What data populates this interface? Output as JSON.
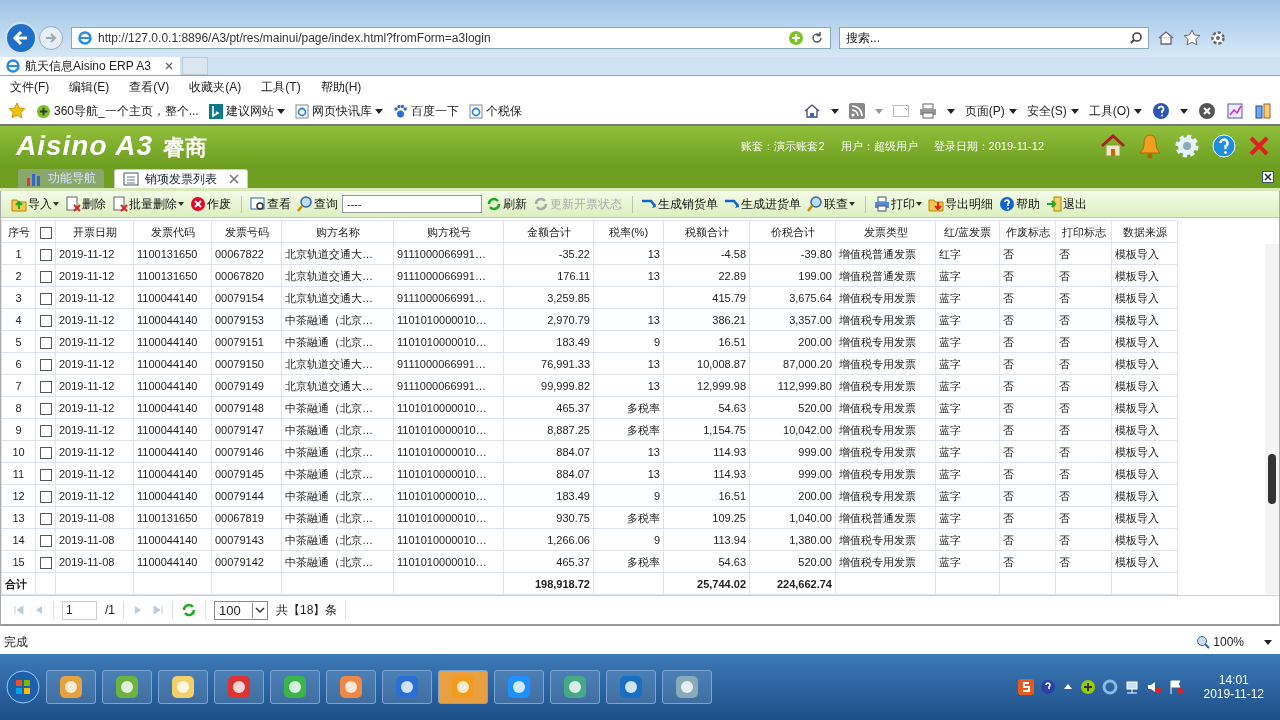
{
  "browser": {
    "url": "http://127.0.0.1:8896/A3/pt/res/mainui/page/index.html?fromForm=a3login",
    "search_placeholder": "搜索...",
    "tab_title": "航天信息Aisino ERP A3",
    "menu": [
      "文件(F)",
      "编辑(E)",
      "查看(V)",
      "收藏夹(A)",
      "工具(T)",
      "帮助(H)"
    ],
    "favorites": [
      {
        "label": "360导航_一个主页，整个...",
        "kind": "plus",
        "dropdown": false
      },
      {
        "label": "建议网站",
        "kind": "bing",
        "dropdown": true
      },
      {
        "label": "网页快讯库",
        "kind": "ie",
        "dropdown": true
      },
      {
        "label": "百度一下",
        "kind": "paw",
        "dropdown": false
      },
      {
        "label": "个税保",
        "kind": "ie",
        "dropdown": false
      }
    ],
    "commands": [
      "页面(P)",
      "安全(S)",
      "工具(O)"
    ]
  },
  "app": {
    "logo": "Aisino A3",
    "product": "睿商",
    "account": "账套：演示账套2",
    "user": "用户：超级用户",
    "login_date": "登录日期：2019-11-12",
    "tabs": [
      {
        "label": "功能导航",
        "selected": false,
        "closable": false
      },
      {
        "label": "销项发票列表",
        "selected": true,
        "closable": true
      }
    ]
  },
  "toolbar": [
    {
      "label": "导入",
      "kind": "import",
      "dropdown": true,
      "disabled": false,
      "group_start": false
    },
    {
      "label": "删除",
      "kind": "delete",
      "dropdown": false,
      "disabled": false,
      "group_start": false
    },
    {
      "label": "批量删除",
      "kind": "delete",
      "dropdown": true,
      "disabled": false,
      "group_start": false
    },
    {
      "label": "作废",
      "kind": "void",
      "dropdown": false,
      "disabled": false,
      "group_start": false
    },
    {
      "label": "查看",
      "kind": "view",
      "dropdown": false,
      "disabled": false,
      "group_start": true
    },
    {
      "label": "查询",
      "kind": "search",
      "dropdown": false,
      "disabled": false,
      "group_start": false
    },
    {
      "label": "----",
      "kind": "field"
    },
    {
      "label": "刷新",
      "kind": "refresh",
      "dropdown": false,
      "disabled": false,
      "group_start": false
    },
    {
      "label": "更新开票状态",
      "kind": "refresh",
      "dropdown": false,
      "disabled": true,
      "group_start": false
    },
    {
      "label": "生成销货单",
      "kind": "arrow",
      "dropdown": false,
      "disabled": false,
      "group_start": true
    },
    {
      "label": "生成进货单",
      "kind": "arrow",
      "dropdown": false,
      "disabled": false,
      "group_start": false
    },
    {
      "label": "联查",
      "kind": "search",
      "dropdown": true,
      "disabled": false,
      "group_start": false
    },
    {
      "label": "打印",
      "kind": "print",
      "dropdown": true,
      "disabled": false,
      "group_start": true
    },
    {
      "label": "导出明细",
      "kind": "export",
      "dropdown": false,
      "disabled": false,
      "group_start": false
    },
    {
      "label": "帮助",
      "kind": "help",
      "dropdown": false,
      "disabled": false,
      "group_start": false
    },
    {
      "label": "退出",
      "kind": "exit",
      "dropdown": false,
      "disabled": false,
      "group_start": false
    }
  ],
  "table": {
    "columns": [
      "序号",
      "开票日期",
      "发票代码",
      "发票号码",
      "购方名称",
      "购方税号",
      "金额合计",
      "税率(%)",
      "税额合计",
      "价税合计",
      "发票类型",
      "红/蓝发票",
      "作废标志",
      "打印标志",
      "数据来源"
    ],
    "select_all": false,
    "rows": [
      {
        "no": "1",
        "checked": false,
        "date": "2019-11-12",
        "code": "1100131650",
        "number": "00067822",
        "buyer": "北京轨道交通大…",
        "tax_id": "9111000066991…",
        "amount": "-35.22",
        "rate": "13",
        "tax": "-4.58",
        "total": "-39.80",
        "type": "增值税普通发票",
        "color_type": "红字",
        "void": "否",
        "printed": "否",
        "source": "模板导入"
      },
      {
        "no": "2",
        "checked": false,
        "date": "2019-11-12",
        "code": "1100131650",
        "number": "00067820",
        "buyer": "北京轨道交通大…",
        "tax_id": "9111000066991…",
        "amount": "176.11",
        "rate": "13",
        "tax": "22.89",
        "total": "199.00",
        "type": "增值税普通发票",
        "color_type": "蓝字",
        "void": "否",
        "printed": "否",
        "source": "模板导入"
      },
      {
        "no": "3",
        "checked": false,
        "date": "2019-11-12",
        "code": "1100044140",
        "number": "00079154",
        "buyer": "北京轨道交通大…",
        "tax_id": "9111000066991…",
        "amount": "3,259.85",
        "tax": "415.79",
        "total": "3,675.64",
        "type": "增值税专用发票",
        "color_type": "蓝字",
        "void": "否",
        "printed": "否",
        "source": "模板导入"
      },
      {
        "no": "4",
        "checked": false,
        "date": "2019-11-12",
        "code": "1100044140",
        "number": "00079153",
        "buyer": "中茶融通（北京…",
        "tax_id": "1101010000010…",
        "amount": "2,970.79",
        "rate": "13",
        "tax": "386.21",
        "total": "3,357.00",
        "type": "增值税专用发票",
        "color_type": "蓝字",
        "void": "否",
        "printed": "否",
        "source": "模板导入"
      },
      {
        "no": "5",
        "checked": false,
        "date": "2019-11-12",
        "code": "1100044140",
        "number": "00079151",
        "buyer": "中茶融通（北京…",
        "tax_id": "1101010000010…",
        "amount": "183.49",
        "rate": "9",
        "tax": "16.51",
        "total": "200.00",
        "type": "增值税专用发票",
        "color_type": "蓝字",
        "void": "否",
        "printed": "否",
        "source": "模板导入"
      },
      {
        "no": "6",
        "checked": false,
        "date": "2019-11-12",
        "code": "1100044140",
        "number": "00079150",
        "buyer": "北京轨道交通大…",
        "tax_id": "9111000066991…",
        "amount": "76,991.33",
        "rate": "13",
        "tax": "10,008.87",
        "total": "87,000.20",
        "type": "增值税专用发票",
        "color_type": "蓝字",
        "void": "否",
        "printed": "否",
        "source": "模板导入"
      },
      {
        "no": "7",
        "checked": false,
        "date": "2019-11-12",
        "code": "1100044140",
        "number": "00079149",
        "buyer": "北京轨道交通大…",
        "tax_id": "9111000066991…",
        "amount": "99,999.82",
        "rate": "13",
        "tax": "12,999.98",
        "total": "112,999.80",
        "type": "增值税专用发票",
        "color_type": "蓝字",
        "void": "否",
        "printed": "否",
        "source": "模板导入"
      },
      {
        "no": "8",
        "checked": false,
        "date": "2019-11-12",
        "code": "1100044140",
        "number": "00079148",
        "buyer": "中茶融通（北京…",
        "tax_id": "1101010000010…",
        "amount": "465.37",
        "rate": "多税率",
        "tax": "54.63",
        "total": "520.00",
        "type": "增值税专用发票",
        "color_type": "蓝字",
        "void": "否",
        "printed": "否",
        "source": "模板导入"
      },
      {
        "no": "9",
        "checked": false,
        "date": "2019-11-12",
        "code": "1100044140",
        "number": "00079147",
        "buyer": "中茶融通（北京…",
        "tax_id": "1101010000010…",
        "amount": "8,887.25",
        "rate": "多税率",
        "tax": "1,154.75",
        "total": "10,042.00",
        "type": "增值税专用发票",
        "color_type": "蓝字",
        "void": "否",
        "printed": "否",
        "source": "模板导入"
      },
      {
        "no": "10",
        "checked": false,
        "date": "2019-11-12",
        "code": "1100044140",
        "number": "00079146",
        "buyer": "中茶融通（北京…",
        "tax_id": "1101010000010…",
        "amount": "884.07",
        "rate": "13",
        "tax": "114.93",
        "total": "999.00",
        "type": "增值税专用发票",
        "color_type": "蓝字",
        "void": "否",
        "printed": "否",
        "source": "模板导入"
      },
      {
        "no": "11",
        "checked": false,
        "date": "2019-11-12",
        "code": "1100044140",
        "number": "00079145",
        "buyer": "中茶融通（北京…",
        "tax_id": "1101010000010…",
        "amount": "884.07",
        "rate": "13",
        "tax": "114.93",
        "total": "999.00",
        "type": "增值税专用发票",
        "color_type": "蓝字",
        "void": "否",
        "printed": "否",
        "source": "模板导入"
      },
      {
        "no": "12",
        "checked": false,
        "date": "2019-11-12",
        "code": "1100044140",
        "number": "00079144",
        "buyer": "中茶融通（北京…",
        "tax_id": "1101010000010…",
        "amount": "183.49",
        "rate": "9",
        "tax": "16.51",
        "total": "200.00",
        "type": "增值税专用发票",
        "color_type": "蓝字",
        "void": "否",
        "printed": "否",
        "source": "模板导入"
      },
      {
        "no": "13",
        "checked": false,
        "date": "2019-11-08",
        "code": "1100131650",
        "number": "00067819",
        "buyer": "中茶融通（北京…",
        "tax_id": "1101010000010…",
        "amount": "930.75",
        "rate": "多税率",
        "tax": "109.25",
        "total": "1,040.00",
        "type": "增值税普通发票",
        "color_type": "蓝字",
        "void": "否",
        "printed": "否",
        "source": "模板导入"
      },
      {
        "no": "14",
        "checked": false,
        "date": "2019-11-08",
        "code": "1100044140",
        "number": "00079143",
        "buyer": "中茶融通（北京…",
        "tax_id": "1101010000010…",
        "amount": "1,266.06",
        "rate": "9",
        "tax": "113.94",
        "total": "1,380.00",
        "type": "增值税专用发票",
        "color_type": "蓝字",
        "void": "否",
        "printed": "否",
        "source": "模板导入"
      },
      {
        "no": "15",
        "checked": false,
        "date": "2019-11-08",
        "code": "1100044140",
        "number": "00079142",
        "buyer": "中茶融通（北京…",
        "tax_id": "1101010000010…",
        "amount": "465.37",
        "rate": "多税率",
        "tax": "54.63",
        "total": "520.00",
        "type": "增值税专用发票",
        "color_type": "蓝字",
        "void": "否",
        "printed": "否",
        "source": "模板导入"
      }
    ],
    "totals": {
      "label": "合计",
      "amount": "198,918.72",
      "tax": "25,744.02",
      "total": "224,662.74"
    }
  },
  "pager": {
    "page": "1",
    "pages": "/1",
    "page_size": "100",
    "count": "共【18】条"
  },
  "status": {
    "text": "完成",
    "zoom": "100%"
  },
  "taskbar": {
    "time": "14:01",
    "date": "2019-11-12"
  }
}
